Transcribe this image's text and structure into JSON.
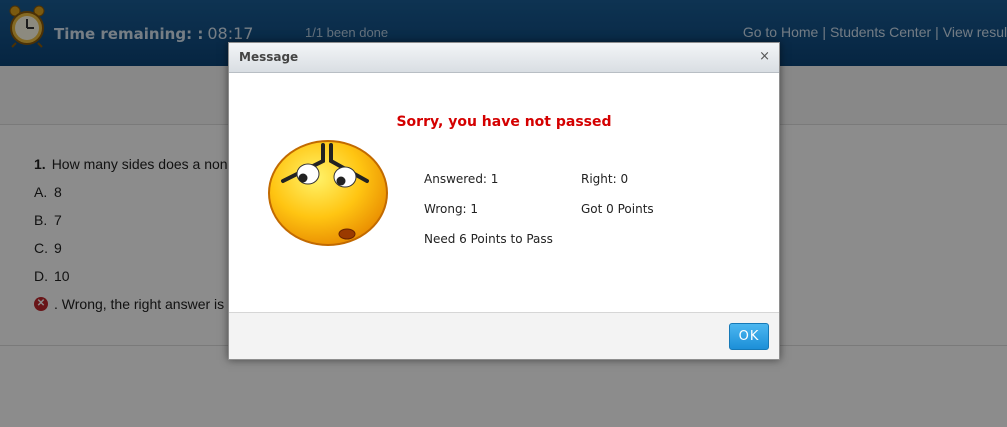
{
  "header": {
    "timer_label": "Time remaining: :",
    "timer_value": "08:17",
    "progress": "1/1 been done",
    "nav": {
      "home": "Go to Home",
      "students": "Students Center",
      "results": "View result"
    }
  },
  "question": {
    "number": "1.",
    "text": "How many sides does a non",
    "options": [
      {
        "letter": "A.",
        "value": "8"
      },
      {
        "letter": "B.",
        "value": "7"
      },
      {
        "letter": "C.",
        "value": "9"
      },
      {
        "letter": "D.",
        "value": "10"
      }
    ],
    "result_text": ".  Wrong, the right answer is"
  },
  "dialog": {
    "title": "Message",
    "close": "×",
    "headline": "Sorry, you have not passed",
    "answered": "Answered: 1",
    "right": "Right: 0",
    "wrong": "Wrong: 1",
    "points": "Got 0 Points",
    "need": "Need 6 Points to Pass",
    "ok": "OK"
  },
  "icons": {
    "clock": "alarm-clock-icon",
    "wrong": "x-circle-icon",
    "face": "sad-face-icon"
  },
  "colors": {
    "header": "#0c4478",
    "headline": "#d40000",
    "ok_button": "#1c8fd8"
  }
}
